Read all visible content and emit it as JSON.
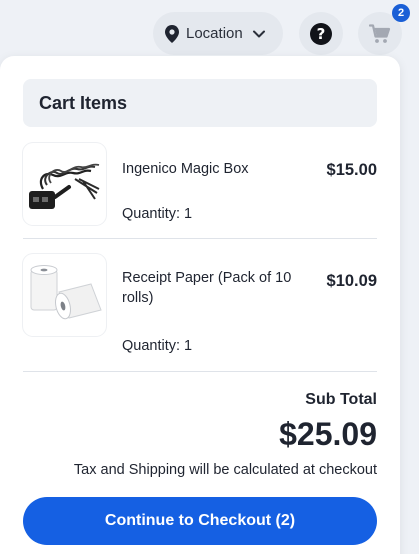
{
  "header": {
    "location_label": "Location",
    "cart_count": "2"
  },
  "cart": {
    "title": "Cart Items",
    "items": [
      {
        "name": "Ingenico Magic Box",
        "price": "$15.00",
        "quantity": "Quantity: 1",
        "image_icon": "cable-device-icon"
      },
      {
        "name": "Receipt Paper (Pack of 10 rolls)",
        "price": "$10.09",
        "quantity": "Quantity: 1",
        "image_icon": "paper-rolls-icon"
      }
    ],
    "subtotal_label": "Sub Total",
    "subtotal_value": "$25.09",
    "tax_note": "Tax and Shipping will be calculated at checkout",
    "checkout_label": "Continue to Checkout (2)"
  },
  "colors": {
    "accent": "#1560e3",
    "badge": "#1a5fd6",
    "background": "#eef1f6"
  }
}
